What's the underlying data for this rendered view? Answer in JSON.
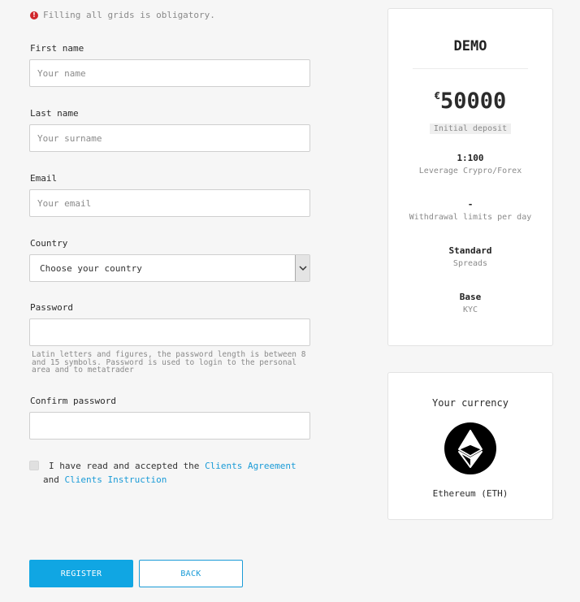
{
  "form": {
    "notice": "Filling all grids is obligatory.",
    "first_name": {
      "label": "First name",
      "placeholder": "Your name",
      "value": ""
    },
    "last_name": {
      "label": "Last name",
      "placeholder": "Your surname",
      "value": ""
    },
    "email": {
      "label": "Email",
      "placeholder": "Your email",
      "value": ""
    },
    "country": {
      "label": "Country",
      "selected": "Choose your country"
    },
    "password": {
      "label": "Password",
      "value": "",
      "hint": "Latin letters and figures, the password length is between 8 and 15 symbols. Password is used to login to the personal area and to metatrader"
    },
    "confirm_password": {
      "label": "Confirm password",
      "value": ""
    },
    "agreement": {
      "text_before": "I have read and accepted the",
      "link1": "Clients Agreement",
      "and": "and",
      "link2": "Clients Instruction",
      "checked": false
    },
    "register_label": "REGISTER",
    "back_label": "BACK"
  },
  "account": {
    "title": "DEMO",
    "currency_symbol": "€",
    "deposit": "50000",
    "deposit_caption": "Initial deposit",
    "stats": [
      {
        "value": "1:100",
        "label": "Leverage Crypro/Forex"
      },
      {
        "value": "-",
        "label": "Withdrawal limits per day"
      },
      {
        "value": "Standard",
        "label": "Spreads"
      },
      {
        "value": "Base",
        "label": "KYC"
      }
    ]
  },
  "currency": {
    "title": "Your currency",
    "icon": "ethereum-icon",
    "name": "Ethereum (ETH)"
  },
  "colors": {
    "accent": "#10a6e3",
    "link": "#1a9bd7",
    "error": "#d0262b",
    "background": "#f6f6f6"
  }
}
